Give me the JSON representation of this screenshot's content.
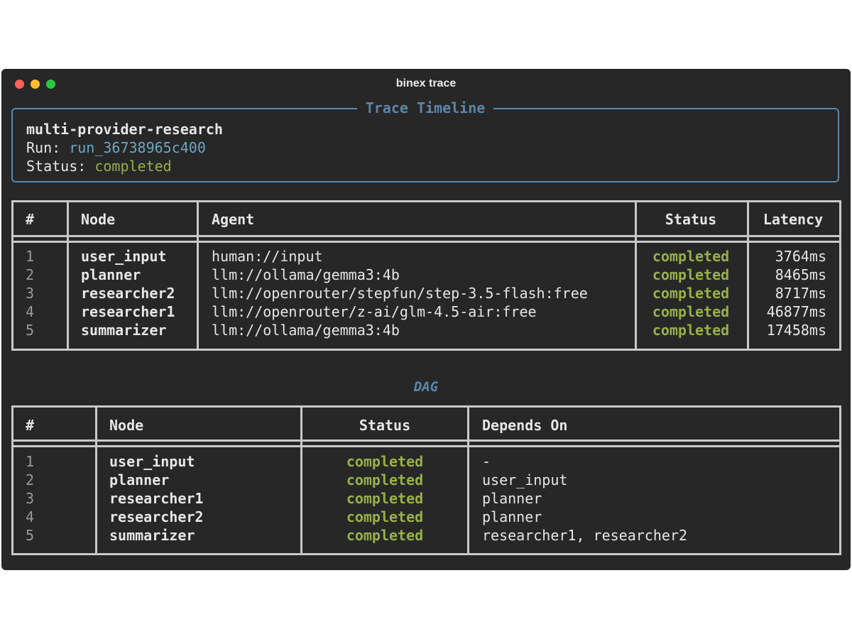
{
  "window": {
    "title": "binex trace"
  },
  "trace_panel": {
    "title": "Trace Timeline",
    "workflow_name": "multi-provider-research",
    "run_label": "Run: ",
    "run_id": "run_36738965c400",
    "status_label": "Status: ",
    "status_value": "completed"
  },
  "timeline": {
    "headers": [
      "#",
      "Node",
      "Agent",
      "Status",
      "Latency"
    ],
    "rows": [
      {
        "num": "1",
        "node": "user_input",
        "agent": "human://input",
        "status": "completed",
        "latency": "3764ms"
      },
      {
        "num": "2",
        "node": "planner",
        "agent": "llm://ollama/gemma3:4b",
        "status": "completed",
        "latency": "8465ms"
      },
      {
        "num": "3",
        "node": "researcher2",
        "agent": "llm://openrouter/stepfun/step-3.5-flash:free",
        "status": "completed",
        "latency": "8717ms"
      },
      {
        "num": "4",
        "node": "researcher1",
        "agent": "llm://openrouter/z-ai/glm-4.5-air:free",
        "status": "completed",
        "latency": "46877ms"
      },
      {
        "num": "5",
        "node": "summarizer",
        "agent": "llm://ollama/gemma3:4b",
        "status": "completed",
        "latency": "17458ms"
      }
    ]
  },
  "dag": {
    "title": "DAG",
    "headers": [
      "#",
      "Node",
      "Status",
      "Depends On"
    ],
    "rows": [
      {
        "num": "1",
        "node": "user_input",
        "status": "completed",
        "depends": "-"
      },
      {
        "num": "2",
        "node": "planner",
        "status": "completed",
        "depends": "user_input"
      },
      {
        "num": "3",
        "node": "researcher1",
        "status": "completed",
        "depends": "planner"
      },
      {
        "num": "4",
        "node": "researcher2",
        "status": "completed",
        "depends": "planner"
      },
      {
        "num": "5",
        "node": "summarizer",
        "status": "completed",
        "depends": "researcher1, researcher2"
      }
    ]
  },
  "colors": {
    "background": "#272727",
    "accent_blue": "#5b86ad",
    "status_green": "#98b04a",
    "run_id_cyan": "#6aa7c0"
  }
}
